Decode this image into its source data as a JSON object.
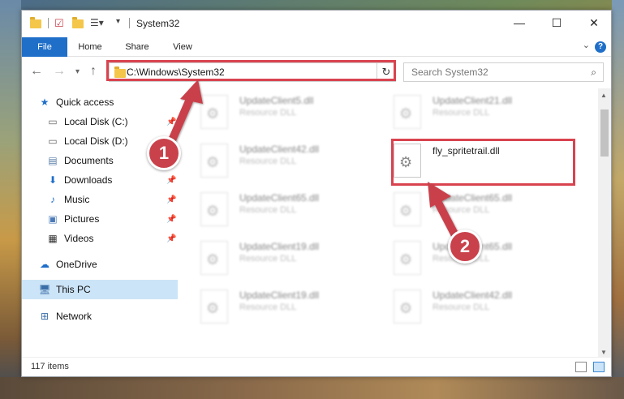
{
  "window": {
    "title": "System32"
  },
  "ribbon": {
    "tabs": [
      "File",
      "Home",
      "Share",
      "View"
    ],
    "help": "?"
  },
  "nav": {
    "address": "C:\\Windows\\System32",
    "search_placeholder": "Search System32"
  },
  "sidebar": {
    "items": [
      {
        "label": "Quick access",
        "icon": "star-icon"
      },
      {
        "label": "Local Disk (C:)",
        "icon": "drive-icon"
      },
      {
        "label": "Local Disk (D:)",
        "icon": "drive-icon"
      },
      {
        "label": "Documents",
        "icon": "documents-icon"
      },
      {
        "label": "Downloads",
        "icon": "download-icon"
      },
      {
        "label": "Music",
        "icon": "music-icon"
      },
      {
        "label": "Pictures",
        "icon": "pictures-icon"
      },
      {
        "label": "Videos",
        "icon": "videos-icon"
      },
      {
        "label": "OneDrive",
        "icon": "cloud-icon"
      },
      {
        "label": "This PC",
        "icon": "computer-icon"
      },
      {
        "label": "Network",
        "icon": "network-icon"
      }
    ]
  },
  "files": [
    {
      "name": "UpdateClient5.dll",
      "type": "Resource DLL"
    },
    {
      "name": "UpdateClient21.dll",
      "type": "Resource DLL"
    },
    {
      "name": "UpdateClient42.dll",
      "type": "Resource DLL"
    },
    {
      "name": "fly_spritetrail.dll",
      "type": ""
    },
    {
      "name": "UpdateClient65.dll",
      "type": "Resource DLL"
    },
    {
      "name": "UpdateClient65.dll",
      "type": "Resource DLL"
    },
    {
      "name": "UpdateClient19.dll",
      "type": "Resource DLL"
    },
    {
      "name": "UpdateClient65.dll",
      "type": "Resource DLL"
    },
    {
      "name": "UpdateClient19.dll",
      "type": "Resource DLL"
    },
    {
      "name": "UpdateClient42.dll",
      "type": "Resource DLL"
    }
  ],
  "status": {
    "count": "117 items"
  },
  "callouts": {
    "one": "1",
    "two": "2"
  },
  "colors": {
    "accent": "#1f6fc9",
    "highlight": "#d9434f",
    "selection": "#cce4f7"
  }
}
